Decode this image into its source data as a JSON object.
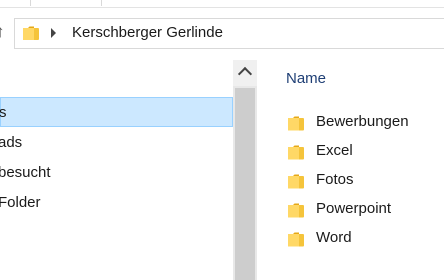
{
  "address": {
    "path_label": "Kerschberger Gerlinde"
  },
  "nav": {
    "items": [
      {
        "label": "s",
        "selected": true
      },
      {
        "label": "ads",
        "selected": false
      },
      {
        "label": "besucht",
        "selected": false
      },
      {
        "label": "Folder",
        "selected": false
      }
    ]
  },
  "content": {
    "column_header": "Name",
    "files": [
      {
        "name": "Bewerbungen",
        "icon": "folder-icon"
      },
      {
        "name": "Excel",
        "icon": "folder-icon"
      },
      {
        "name": "Fotos",
        "icon": "folder-icon"
      },
      {
        "name": "Powerpoint",
        "icon": "folder-icon"
      },
      {
        "name": "Word",
        "icon": "folder-icon"
      }
    ]
  },
  "colors": {
    "selection_bg": "#cce8ff",
    "selection_border": "#99d1ff",
    "header_text": "#1f3f75",
    "folder_yellow": "#f5c43b"
  }
}
